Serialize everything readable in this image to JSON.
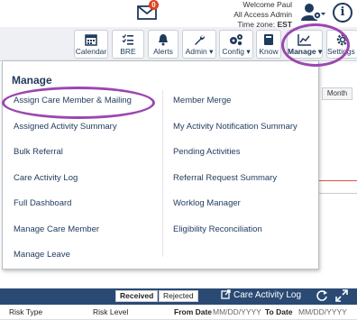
{
  "header": {
    "mail_badge": "0",
    "welcome": "Welcome Paul",
    "access": "All Access Admin",
    "timezone_label": "Time zone:",
    "timezone_value": "EST"
  },
  "toolbar": {
    "buttons": [
      {
        "label": "Calendar",
        "icon": "calendar-icon"
      },
      {
        "label": "BRE",
        "icon": "list-check-icon"
      },
      {
        "label": "Alerts",
        "icon": "bell-icon"
      },
      {
        "label": "Admin ▾",
        "icon": "wrench-icon"
      },
      {
        "label": "Config ▾",
        "icon": "gears-icon"
      },
      {
        "label": "Know",
        "icon": "book-icon"
      },
      {
        "label": "Manage ▾",
        "icon": "chart-icon"
      },
      {
        "label": "Settings ▾",
        "icon": "gear-icon"
      }
    ]
  },
  "manage_menu": {
    "title": "Manage",
    "left_items": [
      "Assign Care Member & Mailing",
      "Assigned Activity Summary",
      "Bulk Referral",
      "Care Activity Log",
      "Full Dashboard",
      "Manage Care Member",
      "Manage Leave"
    ],
    "right_items": [
      "Member Merge",
      "My Activity Notification Summary",
      "Pending Activities",
      "Referral Request Summary",
      "Worklog Manager",
      "Eligibility Reconciliation"
    ]
  },
  "background": {
    "month_button": "Month"
  },
  "bottom_bar": {
    "received": "Received",
    "rejected": "Rejected",
    "care_activity_log": "Care Activity Log"
  },
  "grid": {
    "risk_type": "Risk Type",
    "risk_level": "Risk Level",
    "from_date": "From Date",
    "from_placeholder": "MM/DD/YYYY",
    "to_date": "To Date",
    "to_placeholder": "MM/DD/YYYY"
  },
  "colors": {
    "navy": "#1f3a5c",
    "highlight": "#9b47b0",
    "bottom_bar": "#2a4a74",
    "badge": "#e0421f"
  }
}
